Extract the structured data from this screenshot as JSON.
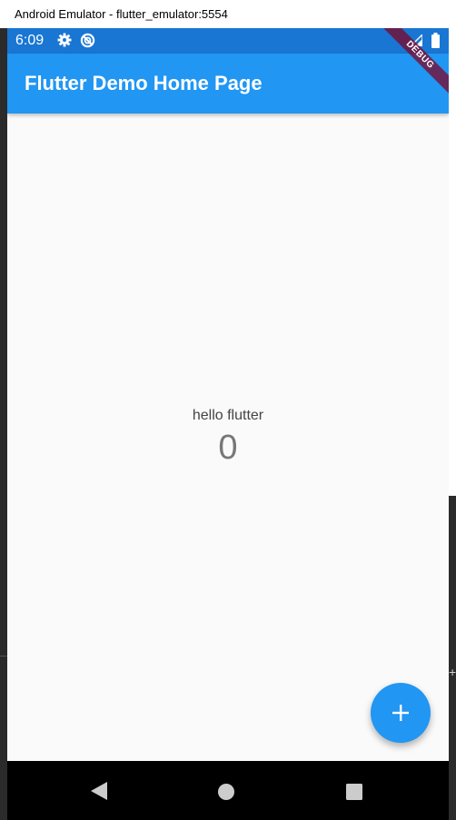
{
  "window": {
    "title": "Android Emulator - flutter_emulator:5554"
  },
  "statusbar": {
    "time": "6:09",
    "icons": [
      "gear-icon",
      "sync-icon",
      "signal-icon",
      "battery-icon"
    ]
  },
  "appbar": {
    "title": "Flutter Demo Home Page"
  },
  "debug_banner": {
    "label": "DEBUG"
  },
  "body": {
    "label": "hello flutter",
    "counter": "0"
  },
  "fab": {
    "icon": "add-icon"
  },
  "navbar": {
    "icons": [
      "back-icon",
      "home-icon",
      "recents-icon"
    ]
  },
  "colors": {
    "statusbar": "#1976d2",
    "primary": "#2196f3",
    "background": "#fafafa",
    "debug_banner": "#800020"
  },
  "background_window": {
    "side_glyph": "+"
  }
}
